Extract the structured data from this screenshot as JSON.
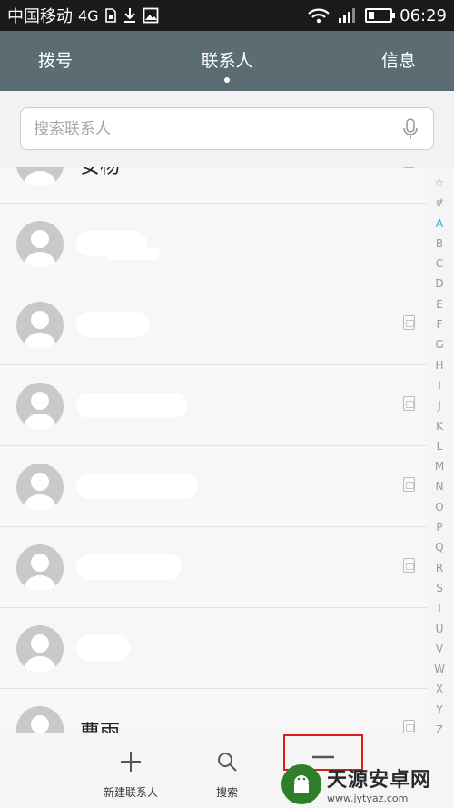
{
  "status_bar": {
    "carrier": "中国移动",
    "network": "4G",
    "time": "06:29",
    "battery_level": 0.22,
    "icons": [
      "sim-icon",
      "download-icon",
      "image-icon",
      "wifi-icon",
      "signal-icon",
      "battery-icon"
    ]
  },
  "tabs": [
    {
      "label": "拨号",
      "active": false
    },
    {
      "label": "联系人",
      "active": true
    },
    {
      "label": "信息",
      "active": false
    }
  ],
  "search": {
    "placeholder": "搜索联系人",
    "value": ""
  },
  "contacts": [
    {
      "name": "安杨",
      "blurred": false,
      "sim": true
    },
    {
      "name": "",
      "blurred": true,
      "sim": false
    },
    {
      "name": "",
      "blurred": true,
      "sim": true
    },
    {
      "name": "",
      "blurred": true,
      "sim": true
    },
    {
      "name": "",
      "blurred": true,
      "sim": true
    },
    {
      "name": "",
      "blurred": true,
      "sim": true
    },
    {
      "name": "",
      "blurred": true,
      "sim": false
    },
    {
      "name": "曹雨",
      "blurred": false,
      "sim": true
    }
  ],
  "alphabet_index": [
    "☆",
    "#",
    "A",
    "B",
    "C",
    "D",
    "E",
    "F",
    "G",
    "H",
    "I",
    "J",
    "K",
    "L",
    "M",
    "N",
    "O",
    "P",
    "Q",
    "R",
    "S",
    "T",
    "U",
    "V",
    "W",
    "X",
    "Y",
    "Z"
  ],
  "alphabet_active": "A",
  "bottom_bar": {
    "new_contact_label": "新建联系人",
    "search_label": "搜索"
  },
  "watermark": {
    "title": "天源安卓网",
    "url": "www.jytyaz.com"
  },
  "colors": {
    "header": "#5b6c73",
    "accent": "#3aa0c6",
    "highlight": "#e01b1b"
  }
}
